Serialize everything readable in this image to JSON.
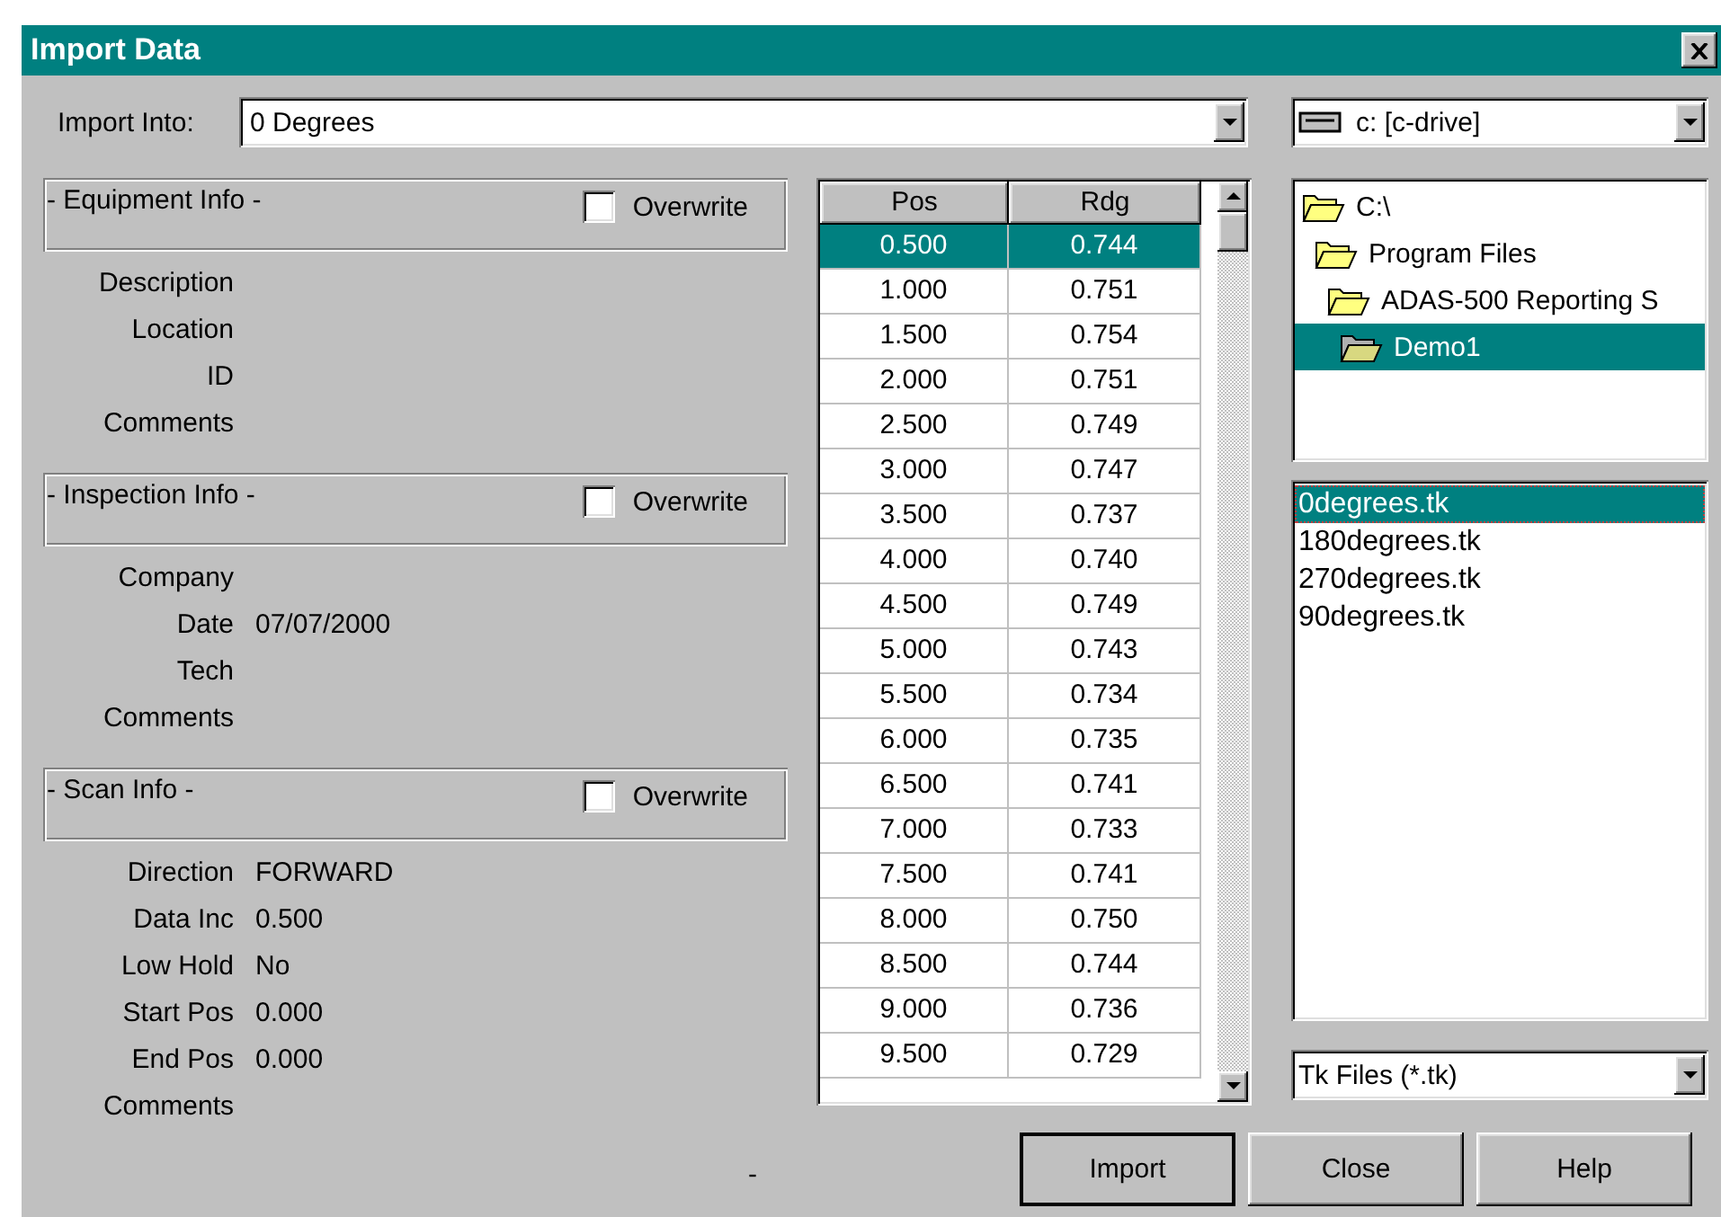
{
  "window": {
    "title": "Import Data"
  },
  "import_into": {
    "label": "Import Into:",
    "value": "0 Degrees"
  },
  "groups": [
    {
      "title": "- Equipment Info -",
      "overwrite": {
        "label": "Overwrite",
        "checked": false
      },
      "fields": [
        {
          "label": "Description"
        },
        {
          "label": "Location"
        },
        {
          "label": "ID"
        },
        {
          "label": "Comments"
        }
      ]
    },
    {
      "title": "- Inspection Info -",
      "overwrite": {
        "label": "Overwrite",
        "checked": false
      },
      "fields": [
        {
          "label": "Company"
        },
        {
          "label": "Date",
          "value": "07/07/2000"
        },
        {
          "label": "Tech"
        },
        {
          "label": "Comments"
        }
      ]
    },
    {
      "title": "- Scan Info -",
      "overwrite": {
        "label": "Overwrite",
        "checked": false
      },
      "fields": [
        {
          "label": "Direction",
          "value": "FORWARD"
        },
        {
          "label": "Data Inc",
          "value": "0.500"
        },
        {
          "label": "Low Hold",
          "value": "No"
        },
        {
          "label": "Start Pos",
          "value": "0.000"
        },
        {
          "label": "End Pos",
          "value": "0.000"
        },
        {
          "label": "Comments"
        }
      ]
    }
  ],
  "table": {
    "columns": [
      "Pos",
      "Rdg"
    ],
    "rows": [
      {
        "cells": [
          "0.500",
          "0.744"
        ],
        "selected": true
      },
      {
        "cells": [
          "1.000",
          "0.751"
        ],
        "selected": false
      },
      {
        "cells": [
          "1.500",
          "0.754"
        ],
        "selected": false
      },
      {
        "cells": [
          "2.000",
          "0.751"
        ],
        "selected": false
      },
      {
        "cells": [
          "2.500",
          "0.749"
        ],
        "selected": false
      },
      {
        "cells": [
          "3.000",
          "0.747"
        ],
        "selected": false
      },
      {
        "cells": [
          "3.500",
          "0.737"
        ],
        "selected": false
      },
      {
        "cells": [
          "4.000",
          "0.740"
        ],
        "selected": false
      },
      {
        "cells": [
          "4.500",
          "0.749"
        ],
        "selected": false
      },
      {
        "cells": [
          "5.000",
          "0.743"
        ],
        "selected": false
      },
      {
        "cells": [
          "5.500",
          "0.734"
        ],
        "selected": false
      },
      {
        "cells": [
          "6.000",
          "0.735"
        ],
        "selected": false
      },
      {
        "cells": [
          "6.500",
          "0.741"
        ],
        "selected": false
      },
      {
        "cells": [
          "7.000",
          "0.733"
        ],
        "selected": false
      },
      {
        "cells": [
          "7.500",
          "0.741"
        ],
        "selected": false
      },
      {
        "cells": [
          "8.000",
          "0.750"
        ],
        "selected": false
      },
      {
        "cells": [
          "8.500",
          "0.744"
        ],
        "selected": false
      },
      {
        "cells": [
          "9.000",
          "0.736"
        ],
        "selected": false
      },
      {
        "cells": [
          "9.500",
          "0.729"
        ],
        "selected": false
      }
    ]
  },
  "drive": {
    "value": "c: [c-drive]"
  },
  "folders": [
    {
      "label": "C:\\",
      "selected": false,
      "children": [
        {
          "label": "Program Files",
          "selected": false,
          "children": [
            {
              "label": "ADAS-500 Reporting S",
              "selected": false,
              "children": [
                {
                  "label": "Demo1",
                  "selected": true
                }
              ]
            }
          ]
        }
      ]
    }
  ],
  "files": [
    {
      "name": "0degrees.tk",
      "selected": true
    },
    {
      "name": "180degrees.tk",
      "selected": false
    },
    {
      "name": "270degrees.tk",
      "selected": false
    },
    {
      "name": "90degrees.tk",
      "selected": false
    }
  ],
  "file_type": {
    "value": "Tk Files (*.tk)"
  },
  "status_mark": "-",
  "buttons": [
    {
      "label": "Import",
      "default": true
    },
    {
      "label": "Close",
      "default": false
    },
    {
      "label": "Help",
      "default": false
    }
  ]
}
